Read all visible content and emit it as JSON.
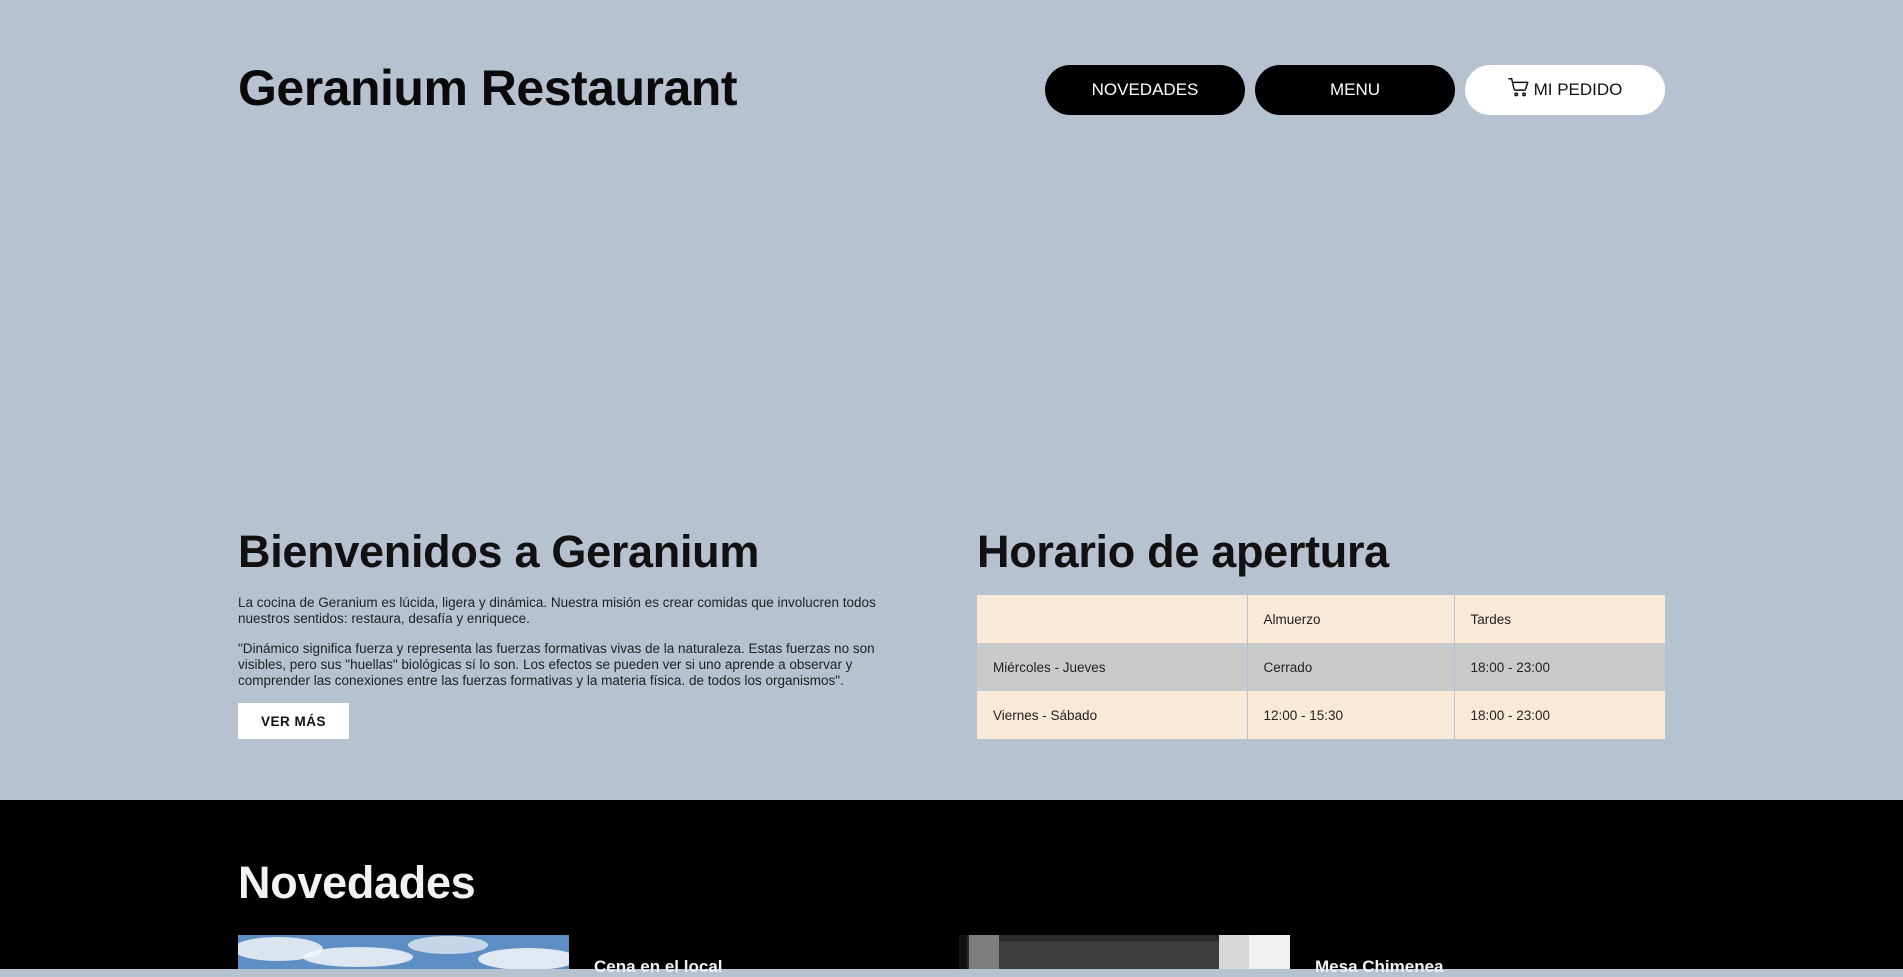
{
  "header": {
    "title": "Geranium Restaurant",
    "nav": [
      {
        "label": "NOVEDADES"
      },
      {
        "label": "MENU"
      },
      {
        "label": "MI PEDIDO",
        "icon": "cart-icon"
      }
    ]
  },
  "welcome": {
    "heading": "Bienvenidos a Geranium",
    "paragraph1": "La cocina de Geranium es lúcida, ligera y dinámica. Nuestra misión es crear comidas que involucren todos nuestros sentidos: restaura, desafía y enriquece.",
    "paragraph2": "\"Dinámico significa fuerza y representa las fuerzas formativas vivas de la naturaleza. Estas fuerzas no son visibles, pero sus \"huellas\" biológicas sí lo son. Los efectos se pueden ver si uno aprende a observar y comprender las conexiones entre las fuerzas formativas y la materia física. de todos los organismos\".",
    "button": "VER MÁS"
  },
  "hours": {
    "heading": "Horario de apertura",
    "columns": [
      "",
      "Almuerzo",
      "Tardes"
    ],
    "rows": [
      {
        "day": "Miércoles - Jueves",
        "lunch": "Cerrado",
        "evening": "18:00 - 23:00"
      },
      {
        "day": "Viernes - Sábado",
        "lunch": "12:00 - 15:30",
        "evening": "18:00 - 23:00"
      }
    ]
  },
  "news": {
    "heading": "Novedades",
    "cards": [
      {
        "title": "Cena en el local"
      },
      {
        "title": "Mesa Chimenea"
      }
    ]
  },
  "colors": {
    "background": "#b6c2cf",
    "table_cream": "#f8ead6",
    "table_grey": "#cacaca",
    "news_background": "#000000"
  }
}
